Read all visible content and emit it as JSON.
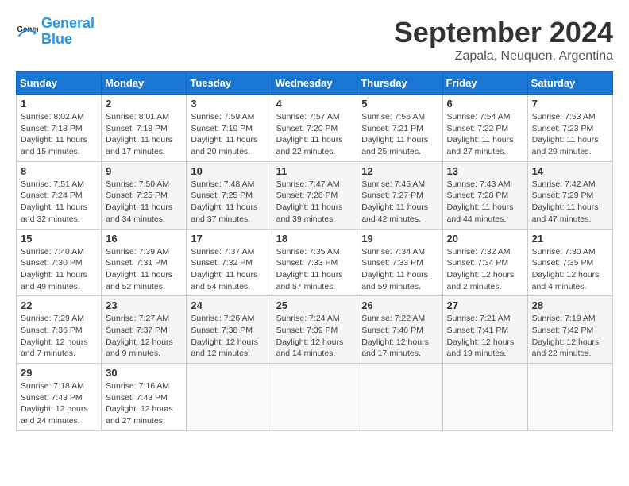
{
  "header": {
    "logo_general": "General",
    "logo_blue": "Blue",
    "month_title": "September 2024",
    "location": "Zapala, Neuquen, Argentina"
  },
  "days_of_week": [
    "Sunday",
    "Monday",
    "Tuesday",
    "Wednesday",
    "Thursday",
    "Friday",
    "Saturday"
  ],
  "weeks": [
    [
      {
        "day": "1",
        "sunrise": "Sunrise: 8:02 AM",
        "sunset": "Sunset: 7:18 PM",
        "daylight": "Daylight: 11 hours and 15 minutes."
      },
      {
        "day": "2",
        "sunrise": "Sunrise: 8:01 AM",
        "sunset": "Sunset: 7:18 PM",
        "daylight": "Daylight: 11 hours and 17 minutes."
      },
      {
        "day": "3",
        "sunrise": "Sunrise: 7:59 AM",
        "sunset": "Sunset: 7:19 PM",
        "daylight": "Daylight: 11 hours and 20 minutes."
      },
      {
        "day": "4",
        "sunrise": "Sunrise: 7:57 AM",
        "sunset": "Sunset: 7:20 PM",
        "daylight": "Daylight: 11 hours and 22 minutes."
      },
      {
        "day": "5",
        "sunrise": "Sunrise: 7:56 AM",
        "sunset": "Sunset: 7:21 PM",
        "daylight": "Daylight: 11 hours and 25 minutes."
      },
      {
        "day": "6",
        "sunrise": "Sunrise: 7:54 AM",
        "sunset": "Sunset: 7:22 PM",
        "daylight": "Daylight: 11 hours and 27 minutes."
      },
      {
        "day": "7",
        "sunrise": "Sunrise: 7:53 AM",
        "sunset": "Sunset: 7:23 PM",
        "daylight": "Daylight: 11 hours and 29 minutes."
      }
    ],
    [
      {
        "day": "8",
        "sunrise": "Sunrise: 7:51 AM",
        "sunset": "Sunset: 7:24 PM",
        "daylight": "Daylight: 11 hours and 32 minutes."
      },
      {
        "day": "9",
        "sunrise": "Sunrise: 7:50 AM",
        "sunset": "Sunset: 7:25 PM",
        "daylight": "Daylight: 11 hours and 34 minutes."
      },
      {
        "day": "10",
        "sunrise": "Sunrise: 7:48 AM",
        "sunset": "Sunset: 7:25 PM",
        "daylight": "Daylight: 11 hours and 37 minutes."
      },
      {
        "day": "11",
        "sunrise": "Sunrise: 7:47 AM",
        "sunset": "Sunset: 7:26 PM",
        "daylight": "Daylight: 11 hours and 39 minutes."
      },
      {
        "day": "12",
        "sunrise": "Sunrise: 7:45 AM",
        "sunset": "Sunset: 7:27 PM",
        "daylight": "Daylight: 11 hours and 42 minutes."
      },
      {
        "day": "13",
        "sunrise": "Sunrise: 7:43 AM",
        "sunset": "Sunset: 7:28 PM",
        "daylight": "Daylight: 11 hours and 44 minutes."
      },
      {
        "day": "14",
        "sunrise": "Sunrise: 7:42 AM",
        "sunset": "Sunset: 7:29 PM",
        "daylight": "Daylight: 11 hours and 47 minutes."
      }
    ],
    [
      {
        "day": "15",
        "sunrise": "Sunrise: 7:40 AM",
        "sunset": "Sunset: 7:30 PM",
        "daylight": "Daylight: 11 hours and 49 minutes."
      },
      {
        "day": "16",
        "sunrise": "Sunrise: 7:39 AM",
        "sunset": "Sunset: 7:31 PM",
        "daylight": "Daylight: 11 hours and 52 minutes."
      },
      {
        "day": "17",
        "sunrise": "Sunrise: 7:37 AM",
        "sunset": "Sunset: 7:32 PM",
        "daylight": "Daylight: 11 hours and 54 minutes."
      },
      {
        "day": "18",
        "sunrise": "Sunrise: 7:35 AM",
        "sunset": "Sunset: 7:33 PM",
        "daylight": "Daylight: 11 hours and 57 minutes."
      },
      {
        "day": "19",
        "sunrise": "Sunrise: 7:34 AM",
        "sunset": "Sunset: 7:33 PM",
        "daylight": "Daylight: 11 hours and 59 minutes."
      },
      {
        "day": "20",
        "sunrise": "Sunrise: 7:32 AM",
        "sunset": "Sunset: 7:34 PM",
        "daylight": "Daylight: 12 hours and 2 minutes."
      },
      {
        "day": "21",
        "sunrise": "Sunrise: 7:30 AM",
        "sunset": "Sunset: 7:35 PM",
        "daylight": "Daylight: 12 hours and 4 minutes."
      }
    ],
    [
      {
        "day": "22",
        "sunrise": "Sunrise: 7:29 AM",
        "sunset": "Sunset: 7:36 PM",
        "daylight": "Daylight: 12 hours and 7 minutes."
      },
      {
        "day": "23",
        "sunrise": "Sunrise: 7:27 AM",
        "sunset": "Sunset: 7:37 PM",
        "daylight": "Daylight: 12 hours and 9 minutes."
      },
      {
        "day": "24",
        "sunrise": "Sunrise: 7:26 AM",
        "sunset": "Sunset: 7:38 PM",
        "daylight": "Daylight: 12 hours and 12 minutes."
      },
      {
        "day": "25",
        "sunrise": "Sunrise: 7:24 AM",
        "sunset": "Sunset: 7:39 PM",
        "daylight": "Daylight: 12 hours and 14 minutes."
      },
      {
        "day": "26",
        "sunrise": "Sunrise: 7:22 AM",
        "sunset": "Sunset: 7:40 PM",
        "daylight": "Daylight: 12 hours and 17 minutes."
      },
      {
        "day": "27",
        "sunrise": "Sunrise: 7:21 AM",
        "sunset": "Sunset: 7:41 PM",
        "daylight": "Daylight: 12 hours and 19 minutes."
      },
      {
        "day": "28",
        "sunrise": "Sunrise: 7:19 AM",
        "sunset": "Sunset: 7:42 PM",
        "daylight": "Daylight: 12 hours and 22 minutes."
      }
    ],
    [
      {
        "day": "29",
        "sunrise": "Sunrise: 7:18 AM",
        "sunset": "Sunset: 7:43 PM",
        "daylight": "Daylight: 12 hours and 24 minutes."
      },
      {
        "day": "30",
        "sunrise": "Sunrise: 7:16 AM",
        "sunset": "Sunset: 7:43 PM",
        "daylight": "Daylight: 12 hours and 27 minutes."
      },
      null,
      null,
      null,
      null,
      null
    ]
  ]
}
